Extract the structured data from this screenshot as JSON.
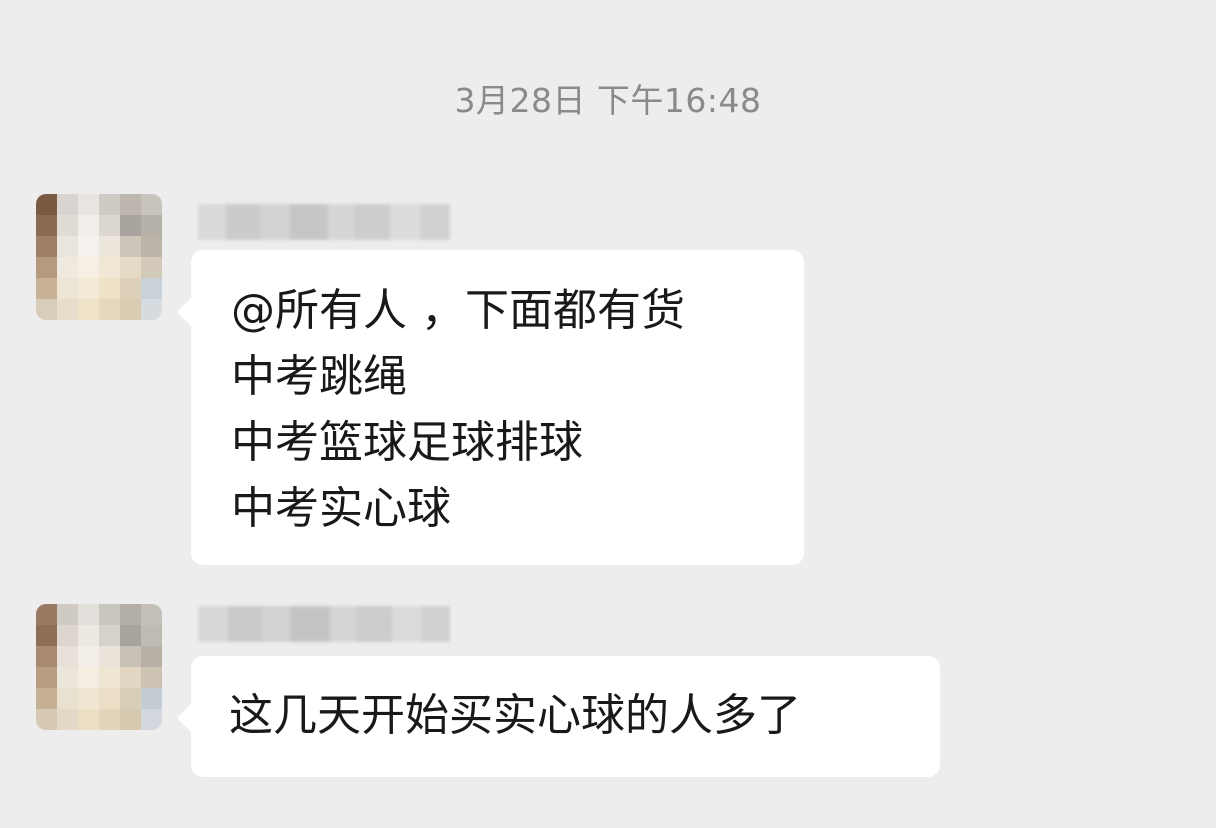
{
  "timestamp": "3月28日 下午16:48",
  "messages": [
    {
      "lines": [
        "@所有人 ，下面都有货",
        "中考跳绳",
        "中考篮球足球排球",
        "中考实心球"
      ]
    },
    {
      "lines": [
        "这几天开始买实心球的人多了"
      ]
    }
  ],
  "colors": {
    "background": "#ededed",
    "bubble": "#ffffff",
    "timestamp": "#8a8a8a",
    "text": "#191919"
  }
}
